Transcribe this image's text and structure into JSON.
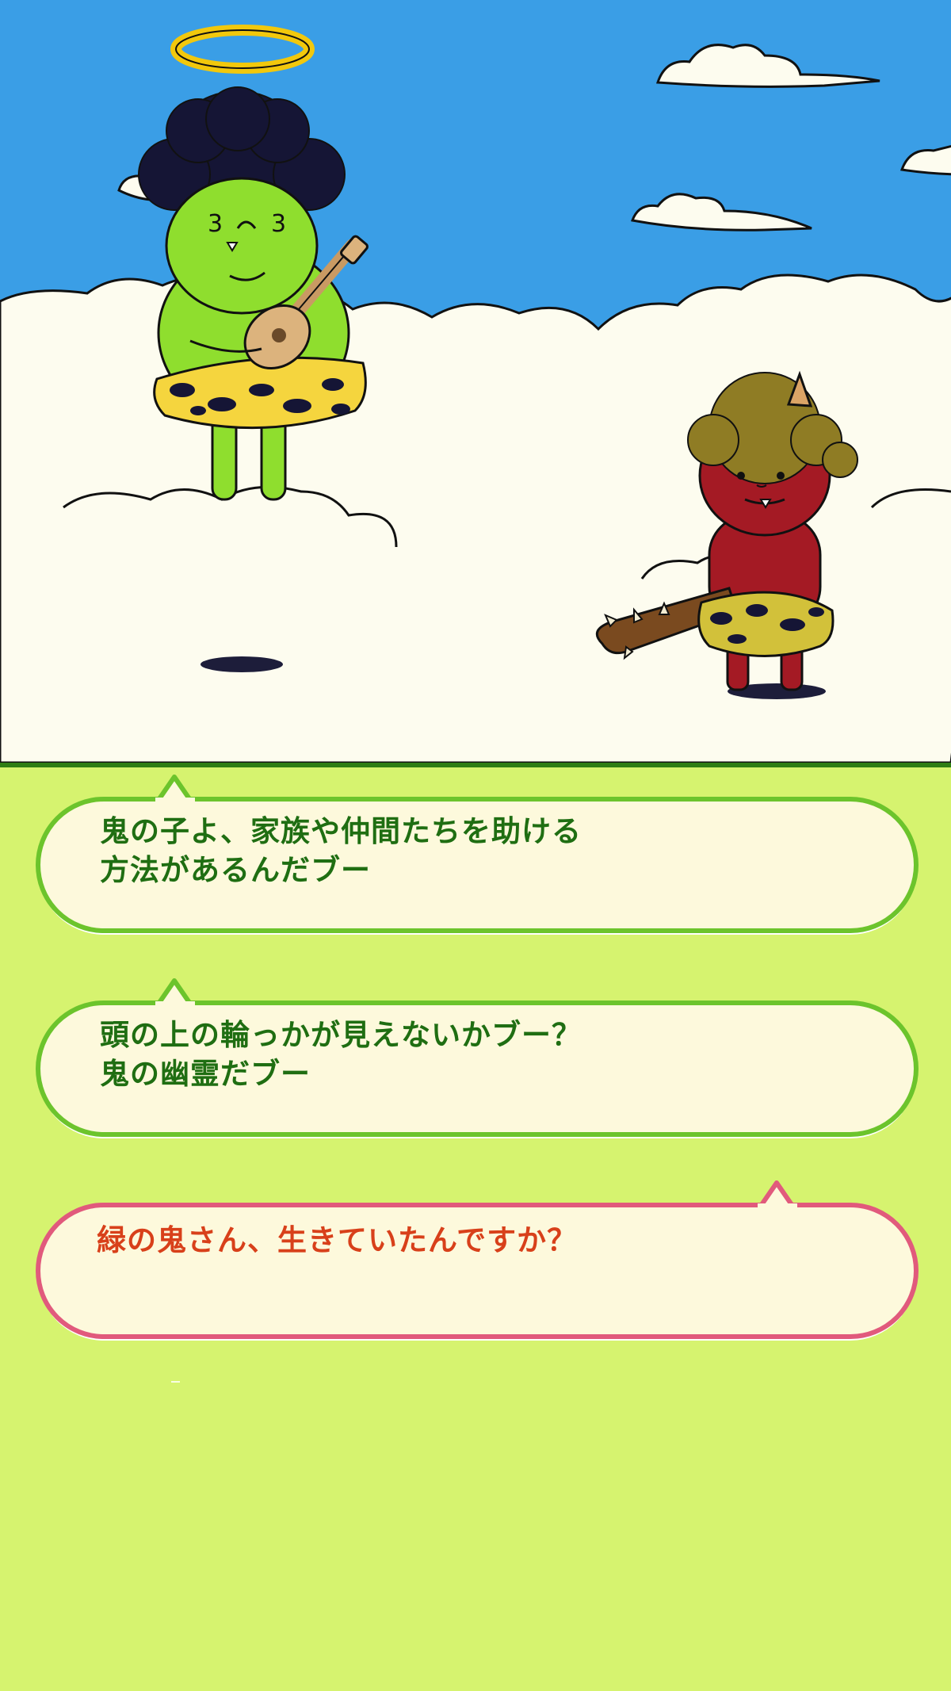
{
  "scene": {
    "sky_color": "#3a9ee6",
    "cloud_color": "#fdfcef",
    "characters": [
      {
        "name": "green-oni-ghost",
        "icon": "green-oni-with-halo-and-ukulele-icon"
      },
      {
        "name": "red-oni-child",
        "icon": "red-oni-with-club-icon"
      }
    ]
  },
  "dialogue": {
    "lines": [
      {
        "speaker_side": "npc",
        "text": "鬼の子よ、家族や仲間たちを助ける\n方法があるんだブー"
      },
      {
        "speaker_side": "npc",
        "text": "頭の上の輪っかが見えないかブー？\n鬼の幽霊だブー"
      },
      {
        "speaker_side": "player",
        "text": "緑の鬼さん、生きていたんですか？"
      }
    ],
    "npc_border_color": "#6cc42c",
    "player_border_color": "#e15a7c",
    "text_bg": "#fdf9dc"
  }
}
